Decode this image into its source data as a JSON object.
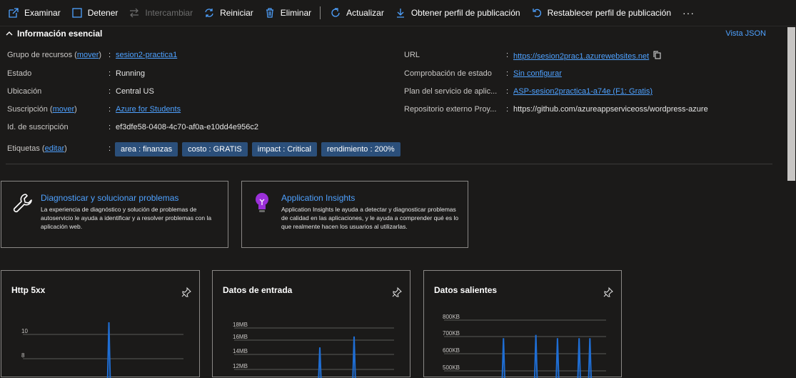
{
  "toolbar": {
    "browse": "Examinar",
    "stop": "Detener",
    "swap": "Intercambiar",
    "restart": "Reiniciar",
    "delete": "Eliminar",
    "refresh": "Actualizar",
    "get_profile": "Obtener perfil de publicación",
    "reset_profile": "Restablecer perfil de publicación",
    "more": "···"
  },
  "essentials": {
    "title": "Información esencial",
    "json_view": "Vista JSON",
    "left": {
      "resource_group_label": "Grupo de recursos",
      "resource_group_move": "mover",
      "resource_group_value": "sesion2-practica1",
      "status_label": "Estado",
      "status_value": "Running",
      "location_label": "Ubicación",
      "location_value": "Central US",
      "subscription_label": "Suscripción",
      "subscription_move": "mover",
      "subscription_value": "Azure for Students",
      "subscription_id_label": "Id. de suscripción",
      "subscription_id_value": "ef3dfe58-0408-4c70-af0a-e10dd4e956c2",
      "tags_label": "Etiquetas",
      "tags_edit": "editar"
    },
    "right": {
      "url_label": "URL",
      "url_value": "https://sesion2prac1.azurewebsites.net",
      "health_label": "Comprobación de estado",
      "health_value": "Sin configurar",
      "plan_label": "Plan del servicio de aplic...",
      "plan_value": "ASP-sesion2practica1-a74e (F1: Gratis)",
      "repo_label": "Repositorio externo Proy...",
      "repo_value": "https://github.com/azureappserviceoss/wordpress-azure"
    },
    "tags": [
      "area : finanzas",
      "costo : GRATIS",
      "impact : Critical",
      "rendimiento : 200%"
    ]
  },
  "cards": {
    "diagnose": {
      "title": "Diagnosticar y solucionar problemas",
      "desc": "La experiencia de diagnóstico y solución de problemas de autoservicio le ayuda a identificar y a resolver problemas con la aplicación web."
    },
    "insights": {
      "title": "Application Insights",
      "desc": "Application Insights le ayuda a detectar y diagnosticar problemas de calidad en las aplicaciones, y le ayuda a comprender qué es lo que realmente hacen los usuarios al utilizarlas."
    }
  },
  "chart_data": [
    {
      "type": "line",
      "title": "Http 5xx",
      "y_ticks": [
        "10",
        "8"
      ],
      "series": [
        {
          "values": [
            0,
            0,
            0,
            0,
            0,
            0,
            0,
            11,
            0,
            0,
            0,
            0,
            0,
            0
          ]
        }
      ]
    },
    {
      "type": "line",
      "title": "Datos de entrada",
      "y_ticks": [
        "18MB",
        "16MB",
        "14MB",
        "12MB"
      ],
      "series": [
        {
          "values": [
            0,
            0,
            0,
            0,
            0,
            0,
            0,
            14.8,
            0,
            0,
            16.6,
            0,
            0,
            0
          ]
        }
      ]
    },
    {
      "type": "line",
      "title": "Datos salientes",
      "y_ticks": [
        "800KB",
        "700KB",
        "600KB",
        "500KB"
      ],
      "series": [
        {
          "values": [
            0,
            0,
            0,
            0,
            0,
            690,
            0,
            0,
            710,
            0,
            690,
            0,
            690,
            690,
            0
          ]
        }
      ]
    }
  ],
  "colors": {
    "accent": "#4ea1ff",
    "tag_bg": "#2b4f7a",
    "background": "#1b1a19",
    "chart_line": "#1f6ed4"
  }
}
